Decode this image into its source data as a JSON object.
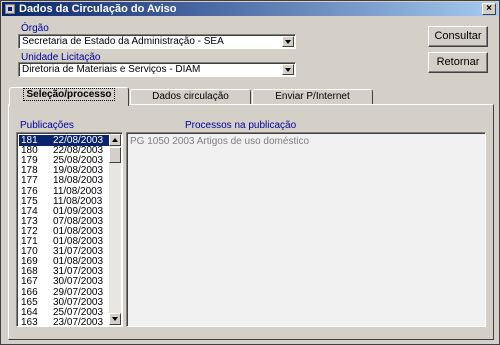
{
  "window": {
    "title": "Dados da Circulação do Aviso",
    "close_label": "×"
  },
  "orgao": {
    "label": "Órgão",
    "value": "Secretaria de Estado da Administração - SEA"
  },
  "unidade": {
    "label": "Unidade Licitação",
    "value": "Diretoria de Materiais e Serviços - DIAM"
  },
  "buttons": {
    "consultar": "Consultar",
    "retornar": "Retornar"
  },
  "tabs": [
    {
      "label": "Seleção/processo",
      "active": true
    },
    {
      "label": "Dados circulação",
      "active": false
    },
    {
      "label": "Enviar P/Internet",
      "active": false
    }
  ],
  "publicacoes": {
    "label": "Publicações",
    "rows": [
      {
        "num": "181",
        "date": "22/08/2003"
      },
      {
        "num": "180",
        "date": "22/08/2003"
      },
      {
        "num": "179",
        "date": "25/08/2003"
      },
      {
        "num": "178",
        "date": "19/08/2003"
      },
      {
        "num": "177",
        "date": "18/08/2003"
      },
      {
        "num": "176",
        "date": "11/08/2003"
      },
      {
        "num": "175",
        "date": "11/08/2003"
      },
      {
        "num": "174",
        "date": "01/09/2003"
      },
      {
        "num": "173",
        "date": "07/08/2003"
      },
      {
        "num": "172",
        "date": "01/08/2003"
      },
      {
        "num": "171",
        "date": "01/08/2003"
      },
      {
        "num": "170",
        "date": "31/07/2003"
      },
      {
        "num": "169",
        "date": "01/08/2003"
      },
      {
        "num": "168",
        "date": "31/07/2003"
      },
      {
        "num": "167",
        "date": "30/07/2003"
      },
      {
        "num": "166",
        "date": "29/07/2003"
      },
      {
        "num": "165",
        "date": "30/07/2003"
      },
      {
        "num": "164",
        "date": "25/07/2003"
      },
      {
        "num": "163",
        "date": "23/07/2003"
      }
    ],
    "selected_index": 0
  },
  "processos": {
    "label": "Processos na publicação",
    "items": [
      "PG 1050 2003   Artigos de uso doméstico"
    ]
  },
  "colors": {
    "accent": "#0a246a",
    "label_blue": "#0000a0",
    "face": "#d4d0c8"
  }
}
